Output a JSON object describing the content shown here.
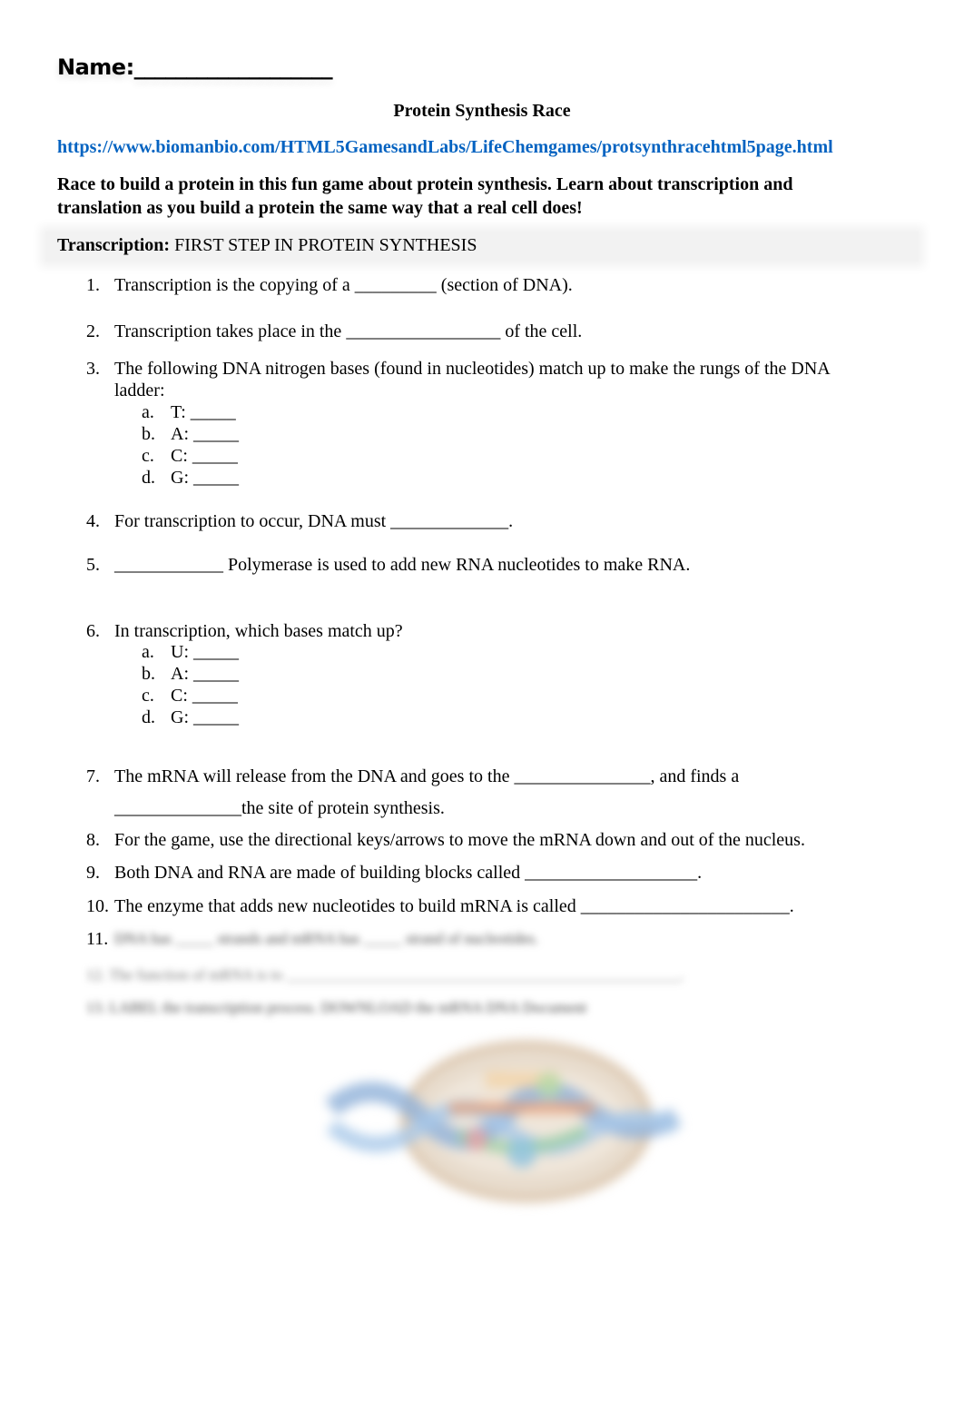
{
  "header": {
    "name_label": "Name:___________________",
    "title": "Protein Synthesis Race",
    "link": "https://www.biomanbio.com/HTML5GamesandLabs/LifeChemgames/protsynthracehtml5page.html",
    "intro": "Race to build a protein in this fun game about protein synthesis. Learn about transcription and translation as you build a protein the same way that a real cell does!"
  },
  "section": {
    "label": "Transcription:",
    "subtitle": " FIRST STEP IN PROTEIN SYNTHESIS"
  },
  "questions": [
    {
      "num": "1.",
      "text": "Transcription is the copying of a _________ (section of DNA)."
    },
    {
      "num": "2.",
      "text": "Transcription takes place in the _________________ of the cell."
    },
    {
      "num": "3.",
      "text": "The following DNA nitrogen bases (found in nucleotides) match up to make the rungs of the DNA ladder:",
      "subs": [
        {
          "l": "a.",
          "t": "T: _____"
        },
        {
          "l": "b.",
          "t": "A: _____"
        },
        {
          "l": "c.",
          "t": "C: _____"
        },
        {
          "l": "d.",
          "t": "G: _____"
        }
      ]
    },
    {
      "num": "4.",
      "text": "For transcription to occur, DNA must _____________."
    },
    {
      "num": "5.",
      "text": "____________ Polymerase is used to add new RNA nucleotides to make RNA."
    },
    {
      "num": "6.",
      "text": "In transcription, which bases match up?",
      "subs": [
        {
          "l": "a.",
          "t": "U: _____"
        },
        {
          "l": "b.",
          "t": "A: _____"
        },
        {
          "l": "c.",
          "t": "C: _____"
        },
        {
          "l": "d.",
          "t": "G: _____"
        }
      ]
    },
    {
      "num": "7.",
      "text": "The mRNA will release from the DNA and goes to the _______________, and finds a",
      "text2": "______________the site of protein synthesis."
    },
    {
      "num": "8.",
      "text": "For the game, use the directional keys/arrows to move the mRNA down and out of the nucleus."
    },
    {
      "num": "9.",
      "text": "Both DNA and RNA are made of building blocks called ___________________."
    },
    {
      "num": "10.",
      "text": "The enzyme that adds new nucleotides to build mRNA is called _______________________."
    },
    {
      "num": "11.",
      "text": "DNA has _____ strands and mRNA has _____ strand of nucleotides."
    }
  ],
  "blurred_lines": [
    "12. The function of mRNA is to ___________________________________________________.",
    "13. LABEL the transcription process. DOWNLOAD the mRNA DNA Document"
  ],
  "figure": {
    "icon": "transcription-diagram-image"
  }
}
